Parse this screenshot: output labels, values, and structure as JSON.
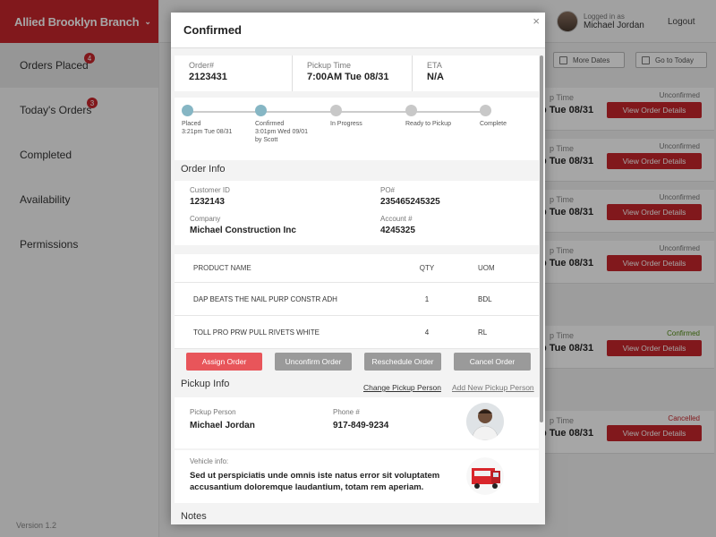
{
  "sidebar": {
    "brand": "Allied Brooklyn Branch",
    "items": [
      {
        "label": "Orders Placed",
        "badge": "4"
      },
      {
        "label": "Today's Orders",
        "badge": "3"
      },
      {
        "label": "Completed"
      },
      {
        "label": "Availability"
      },
      {
        "label": "Permissions"
      }
    ],
    "version": "Version 1.2"
  },
  "header": {
    "logged_in_as": "Logged in as",
    "user_name": "Michael Jordan",
    "logout": "Logout"
  },
  "toolbar": {
    "more_dates": "More Dates",
    "go_to_today": "Go to Today"
  },
  "background_orders": [
    {
      "label": "p Time",
      "time": "p Tue 08/31",
      "status": "Unconfirmed",
      "status_color": "#777777",
      "button": "View Order Details"
    },
    {
      "label": "p Time",
      "time": "p Tue 08/31",
      "status": "Unconfirmed",
      "status_color": "#777777",
      "button": "View Order Details"
    },
    {
      "label": "p Time",
      "time": "p Tue 08/31",
      "status": "Unconfirmed",
      "status_color": "#777777",
      "button": "View Order Details"
    },
    {
      "label": "p Time",
      "time": "p Tue 08/31",
      "status": "Unconfirmed",
      "status_color": "#777777",
      "button": "View Order Details"
    },
    {
      "label": "p Time",
      "time": "p Tue 08/31",
      "status": "Confirmed",
      "status_color": "#4f8a10",
      "button": "View Order Details"
    },
    {
      "label": "p Time",
      "time": "p Tue 08/31",
      "status": "Cancelled",
      "status_color": "#c7262b",
      "button": "View Order Details"
    }
  ],
  "modal": {
    "title": "Confirmed",
    "close": "×",
    "summary": {
      "order_label": "Order#",
      "order_value": "2123431",
      "pickup_label": "Pickup Time",
      "pickup_value": "7:00AM Tue 08/31",
      "eta_label": "ETA",
      "eta_value": "N/A"
    },
    "steps": [
      {
        "name": "Placed",
        "date": "3:21pm Tue 08/31",
        "by": "",
        "done": true
      },
      {
        "name": "Confirmed",
        "date": "3:01pm Wed 09/01",
        "by": "by Scott",
        "done": true
      },
      {
        "name": "In Progress",
        "date": "",
        "by": "",
        "done": false
      },
      {
        "name": "Ready to Pickup",
        "date": "",
        "by": "",
        "done": false
      },
      {
        "name": "Complete",
        "date": "",
        "by": "",
        "done": false
      }
    ],
    "order_info": {
      "title": "Order Info",
      "customer_id_label": "Customer ID",
      "customer_id": "1232143",
      "po_label": "PO#",
      "po": "235465245325",
      "company_label": "Company",
      "company": "Michael Construction Inc",
      "account_label": "Account #",
      "account": "4245325"
    },
    "products": {
      "headers": [
        "PRODUCT NAME",
        "QTY",
        "UOM"
      ],
      "rows": [
        [
          "DAP BEATS THE NAIL PURP CONSTR ADH",
          "1",
          "BDL"
        ],
        [
          "TOLL PRO PRW PULL RIVETS WHITE",
          "4",
          "RL"
        ]
      ]
    },
    "actions": {
      "assign": "Assign Order",
      "unconfirm": "Unconfirm Order",
      "reschedule": "Reschedule Order",
      "cancel": "Cancel Order"
    },
    "pickup_info": {
      "title": "Pickup Info",
      "change": "Change Pickup Person",
      "add_new": "Add New Pickup Person",
      "person_label": "Pickup Person",
      "person": "Michael Jordan",
      "phone_label": "Phone #",
      "phone": "917-849-9234",
      "vehicle_label": "Vehicle info:",
      "vehicle_text": "Sed ut perspiciatis unde omnis iste natus error sit voluptatem accusantium doloremque laudantium, totam rem aperiam."
    },
    "notes_title": "Notes"
  }
}
